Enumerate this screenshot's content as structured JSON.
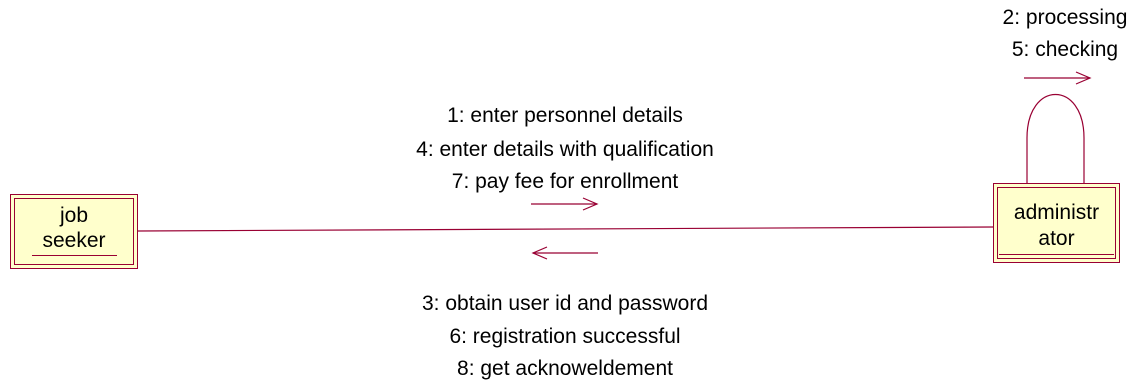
{
  "diagram": {
    "objects": {
      "job_seeker": {
        "line1": "job",
        "line2": "seeker"
      },
      "administrator": {
        "line1": "administr",
        "line2": "ator"
      }
    },
    "self_messages": [
      "2: processing",
      "5: checking"
    ],
    "forward_messages": [
      "1: enter personnel details",
      "4: enter details with qualification",
      "7: pay fee for enrollment"
    ],
    "return_messages": [
      "3: obtain user id and password",
      "6: registration successful",
      "8: get acknoweldement"
    ],
    "colors": {
      "line": "#990033",
      "object_fill": "#ffffcc",
      "text": "#000000"
    }
  }
}
